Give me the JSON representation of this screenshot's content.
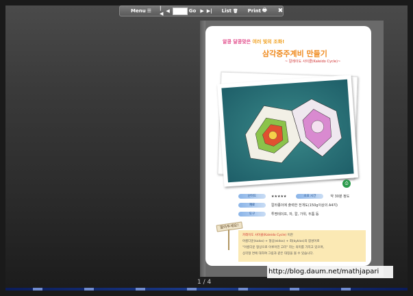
{
  "toolbar": {
    "menu_label": "Menu",
    "menu_glyph": "☰",
    "first_glyph": "|◀",
    "prev_glyph": "◀",
    "page_input_value": "",
    "go_label": "Go",
    "next_glyph": "▶",
    "last_glyph": "▶|",
    "list_label": "List",
    "list_glyph": "🗑",
    "print_label": "Print",
    "print_glyph": "🖶",
    "close_glyph": "✖"
  },
  "page": {
    "headline_1a": "알콩 달콩맞은",
    "headline_1b": "여러 빛의 조화!",
    "headline_2": "삼각중주계비 만들기",
    "headline_3": "~ 칼레이도 사이클(Kaleido Cycle)~",
    "info": [
      {
        "label": "난이도",
        "value": "★★★★★",
        "label2": "소요 시간",
        "value2": "약 30분 정도"
      },
      {
        "label": "재료",
        "value": "칼라종이에 출력한 전개도(150g이상의 A4지)"
      },
      {
        "label": "도구",
        "value": "투명테이프, 자, 칼, 가위, 두툼 등"
      }
    ],
    "sign_label": "알아두세요!",
    "desc_line1_hl": "카레이도 사이클(Kaleido Cycle)",
    "desc_line1": "이란",
    "desc_line2": "아름다운(kalos) + 형상(eidos) + 회(kyklos)의 합성어로",
    "desc_line3": "\"아름다운 형상으로 이루어진 고리\" 라는 의미를 가지고 있으며,",
    "desc_line4": "상각형 면에 대하여 그림과 같은 대칭을 볼 수 있습니다."
  },
  "page_indicator": "1 / 4",
  "watermark": "http://blog.daum.net/mathjapari",
  "colors": {
    "background": "#1a1a1a",
    "accent_orange": "#ef8a1e",
    "accent_pink": "#e24b8a",
    "pill_blue": "#8ab4e8",
    "desc_bg": "#fbe9b4"
  }
}
